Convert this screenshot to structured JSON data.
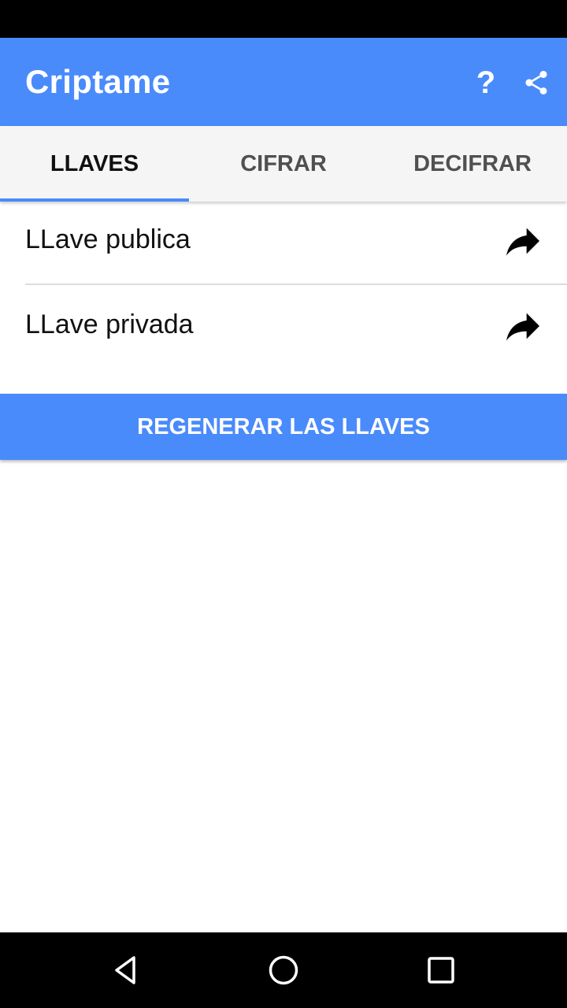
{
  "app_bar": {
    "title": "Criptame",
    "help_label": "?",
    "share_icon": "share-icon",
    "color": "#4a8bfc"
  },
  "tabs": [
    {
      "label": "LLAVES",
      "active": true
    },
    {
      "label": "CIFRAR",
      "active": false
    },
    {
      "label": "DECIFRAR",
      "active": false
    }
  ],
  "keys": [
    {
      "label": "LLave publica",
      "icon": "share-arrow-icon"
    },
    {
      "label": "LLave privada",
      "icon": "share-arrow-icon"
    }
  ],
  "regenerate_button": {
    "label": "REGENERAR LAS LLAVES"
  },
  "nav_bar": {
    "icons": [
      "back-icon",
      "home-icon",
      "recents-icon"
    ]
  }
}
